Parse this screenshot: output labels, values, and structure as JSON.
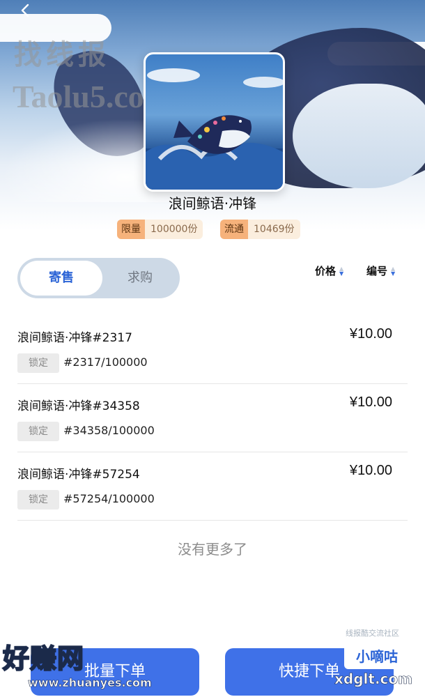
{
  "header": {
    "back_icon": "chevron-left-icon",
    "watermark_top_cn": "找线报",
    "watermark_top_en": "Taolu5.com"
  },
  "product": {
    "title": "浪间鲸语·冲锋",
    "limit_label": "限量",
    "limit_value": "100000份",
    "circulation_label": "流通",
    "circulation_value": "10469份"
  },
  "tabs": [
    {
      "label": "寄售",
      "active": true
    },
    {
      "label": "求购",
      "active": false
    }
  ],
  "sort": {
    "price_label": "价格",
    "number_label": "编号"
  },
  "listings": [
    {
      "name": "浪间鲸语·冲锋#2317",
      "price": "¥10.00",
      "status": "锁定",
      "serial": "#2317/100000"
    },
    {
      "name": "浪间鲸语·冲锋#34358",
      "price": "¥10.00",
      "status": "锁定",
      "serial": "#34358/100000"
    },
    {
      "name": "浪间鲸语·冲锋#57254",
      "price": "¥10.00",
      "status": "锁定",
      "serial": "#57254/100000"
    }
  ],
  "list_footer": "没有更多了",
  "bottom": {
    "left_button": "批量下单",
    "right_button": "快捷下单"
  },
  "watermarks": {
    "community": "线报酷交流社区",
    "haozhuan": "好赚网",
    "zhuanyes": "www.zhuanyes.com",
    "xiaodi": "小嘀咕",
    "xdglt": "xdglt.com"
  },
  "colors": {
    "accent": "#3f71e8",
    "tag_key": "#f6b27b",
    "tag_value": "#fbeede"
  }
}
